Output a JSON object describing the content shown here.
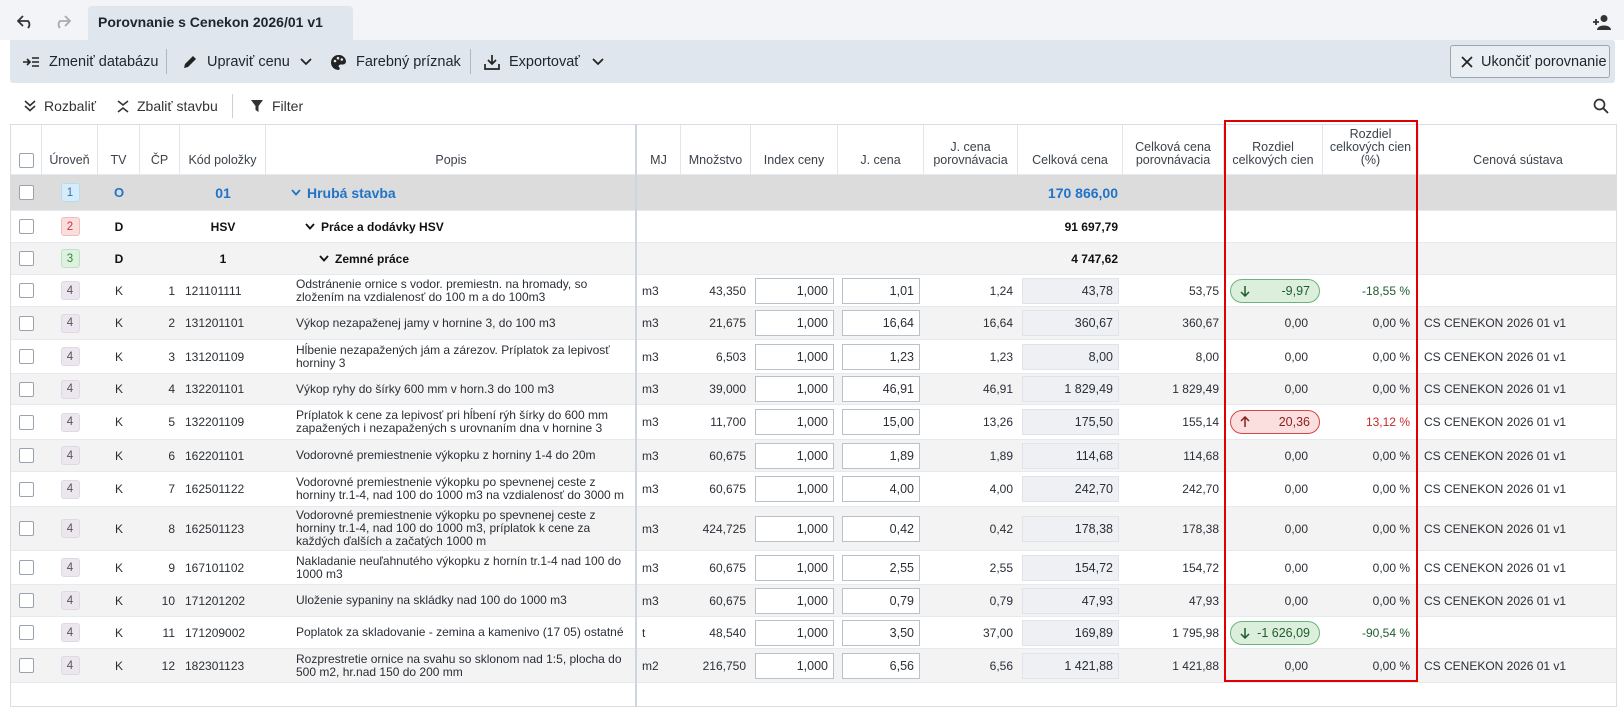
{
  "tab_title": "Porovnanie s Cenekon 2026/01 v1",
  "toolbar": {
    "change_db": "Zmeniť databázu",
    "edit_price": "Upraviť cenu",
    "color_flag": "Farebný príznak",
    "export": "Exportovať",
    "end_compare": "Ukončiť porovnanie"
  },
  "toolbar2": {
    "expand": "Rozbaliť",
    "collapse": "Zbaliť stavbu",
    "filter": "Filter"
  },
  "headers": {
    "level": "Úroveň",
    "tv": "TV",
    "cp": "ČP",
    "code": "Kód položky",
    "desc": "Popis",
    "mj": "MJ",
    "qty": "Množstvo",
    "price_index": "Index ceny",
    "unit_price": "J. cena",
    "unit_price_cmp": "J. cena porovnávacia",
    "total": "Celková cena",
    "total_cmp": "Celková cena porovnávacia",
    "diff": "Rozdiel celkových cien",
    "diff_pct": "Rozdiel celkových cien (%)",
    "system": "Cenová sústava"
  },
  "groups": [
    {
      "level": "1",
      "tv": "O",
      "code": "01",
      "desc": "Hrubá stavba",
      "total": "170 866,00"
    },
    {
      "level": "2",
      "tv": "D",
      "code": "HSV",
      "desc": "Práce a dodávky HSV",
      "total": "91 697,79"
    },
    {
      "level": "3",
      "tv": "D",
      "code": "1",
      "desc": "Zemné práce",
      "total": "4 747,62"
    }
  ],
  "rows": [
    {
      "level": "4",
      "tv": "K",
      "cp": "1",
      "code": "121101111",
      "desc": "Odstránenie ornice s vodor. premiestn. na hromady, so zložením na vzdialenosť do 100 m a do 100m3",
      "mj": "m3",
      "qty": "43,350",
      "index": "1,000",
      "unit": "1,01",
      "unit_cmp": "1,24",
      "total": "43,78",
      "total_cmp": "53,75",
      "diff": "-9,97",
      "diff_pct": "-18,55 %",
      "system": "",
      "badge": "down"
    },
    {
      "level": "4",
      "tv": "K",
      "cp": "2",
      "code": "131201101",
      "desc": "Výkop nezapaženej jamy v hornine 3, do 100 m3",
      "mj": "m3",
      "qty": "21,675",
      "index": "1,000",
      "unit": "16,64",
      "unit_cmp": "16,64",
      "total": "360,67",
      "total_cmp": "360,67",
      "diff": "0,00",
      "diff_pct": "0,00 %",
      "system": "CS CENEKON 2026 01 v1",
      "badge": ""
    },
    {
      "level": "4",
      "tv": "K",
      "cp": "3",
      "code": "131201109",
      "desc": "Hĺbenie nezapažených jám a zárezov. Príplatok za lepivosť horniny 3",
      "mj": "m3",
      "qty": "6,503",
      "index": "1,000",
      "unit": "1,23",
      "unit_cmp": "1,23",
      "total": "8,00",
      "total_cmp": "8,00",
      "diff": "0,00",
      "diff_pct": "0,00 %",
      "system": "CS CENEKON 2026 01 v1",
      "badge": ""
    },
    {
      "level": "4",
      "tv": "K",
      "cp": "4",
      "code": "132201101",
      "desc": "Výkop ryhy do šírky 600 mm v horn.3 do 100 m3",
      "mj": "m3",
      "qty": "39,000",
      "index": "1,000",
      "unit": "46,91",
      "unit_cmp": "46,91",
      "total": "1 829,49",
      "total_cmp": "1 829,49",
      "diff": "0,00",
      "diff_pct": "0,00 %",
      "system": "CS CENEKON 2026 01 v1",
      "badge": ""
    },
    {
      "level": "4",
      "tv": "K",
      "cp": "5",
      "code": "132201109",
      "desc": "Príplatok k cene za lepivosť pri hĺbení rýh šírky do 600 mm zapažených i nezapažených s urovnaním dna v hornine 3",
      "mj": "m3",
      "qty": "11,700",
      "index": "1,000",
      "unit": "15,00",
      "unit_cmp": "13,26",
      "total": "175,50",
      "total_cmp": "155,14",
      "diff": "20,36",
      "diff_pct": "13,12 %",
      "system": "CS CENEKON 2026 01 v1",
      "badge": "up"
    },
    {
      "level": "4",
      "tv": "K",
      "cp": "6",
      "code": "162201101",
      "desc": "Vodorovné premiestnenie výkopku z horniny 1-4 do 20m",
      "mj": "m3",
      "qty": "60,675",
      "index": "1,000",
      "unit": "1,89",
      "unit_cmp": "1,89",
      "total": "114,68",
      "total_cmp": "114,68",
      "diff": "0,00",
      "diff_pct": "0,00 %",
      "system": "CS CENEKON 2026 01 v1",
      "badge": ""
    },
    {
      "level": "4",
      "tv": "K",
      "cp": "7",
      "code": "162501122",
      "desc": "Vodorovné premiestnenie výkopku po spevnenej ceste z horniny tr.1-4, nad 100 do 1000 m3 na vzdialenosť do 3000 m",
      "mj": "m3",
      "qty": "60,675",
      "index": "1,000",
      "unit": "4,00",
      "unit_cmp": "4,00",
      "total": "242,70",
      "total_cmp": "242,70",
      "diff": "0,00",
      "diff_pct": "0,00 %",
      "system": "CS CENEKON 2026 01 v1",
      "badge": ""
    },
    {
      "level": "4",
      "tv": "K",
      "cp": "8",
      "code": "162501123",
      "desc": "Vodorovné premiestnenie výkopku po spevnenej ceste z horniny tr.1-4, nad 100 do 1000 m3, príplatok k cene za každých ďalších a začatých 1000 m",
      "mj": "m3",
      "qty": "424,725",
      "index": "1,000",
      "unit": "0,42",
      "unit_cmp": "0,42",
      "total": "178,38",
      "total_cmp": "178,38",
      "diff": "0,00",
      "diff_pct": "0,00 %",
      "system": "CS CENEKON 2026 01 v1",
      "badge": ""
    },
    {
      "level": "4",
      "tv": "K",
      "cp": "9",
      "code": "167101102",
      "desc": "Nakladanie neuľahnutého výkopku z hornín tr.1-4 nad 100 do 1000 m3",
      "mj": "m3",
      "qty": "60,675",
      "index": "1,000",
      "unit": "2,55",
      "unit_cmp": "2,55",
      "total": "154,72",
      "total_cmp": "154,72",
      "diff": "0,00",
      "diff_pct": "0,00 %",
      "system": "CS CENEKON 2026 01 v1",
      "badge": ""
    },
    {
      "level": "4",
      "tv": "K",
      "cp": "10",
      "code": "171201202",
      "desc": "Uloženie sypaniny na skládky nad 100 do 1000 m3",
      "mj": "m3",
      "qty": "60,675",
      "index": "1,000",
      "unit": "0,79",
      "unit_cmp": "0,79",
      "total": "47,93",
      "total_cmp": "47,93",
      "diff": "0,00",
      "diff_pct": "0,00 %",
      "system": "CS CENEKON 2026 01 v1",
      "badge": ""
    },
    {
      "level": "4",
      "tv": "K",
      "cp": "11",
      "code": "171209002",
      "desc": "Poplatok za skladovanie - zemina a kamenivo (17 05) ostatné",
      "mj": "t",
      "qty": "48,540",
      "index": "1,000",
      "unit": "3,50",
      "unit_cmp": "37,00",
      "total": "169,89",
      "total_cmp": "1 795,98",
      "diff": "-1 626,09",
      "diff_pct": "-90,54 %",
      "system": "",
      "badge": "down"
    },
    {
      "level": "4",
      "tv": "K",
      "cp": "12",
      "code": "182301123",
      "desc": "Rozprestretie ornice na svahu so sklonom nad 1:5, plocha do 500 m2, hr.nad 150 do 200 mm",
      "mj": "m2",
      "qty": "216,750",
      "index": "1,000",
      "unit": "6,56",
      "unit_cmp": "6,56",
      "total": "1 421,88",
      "total_cmp": "1 421,88",
      "diff": "0,00",
      "diff_pct": "0,00 %",
      "system": "CS CENEKON 2026 01 v1",
      "badge": ""
    }
  ],
  "colors": {
    "accent": "#1f74c9",
    "up_badge": "#d64545",
    "down_badge": "#6ab47a",
    "highlight": "#e10000"
  }
}
